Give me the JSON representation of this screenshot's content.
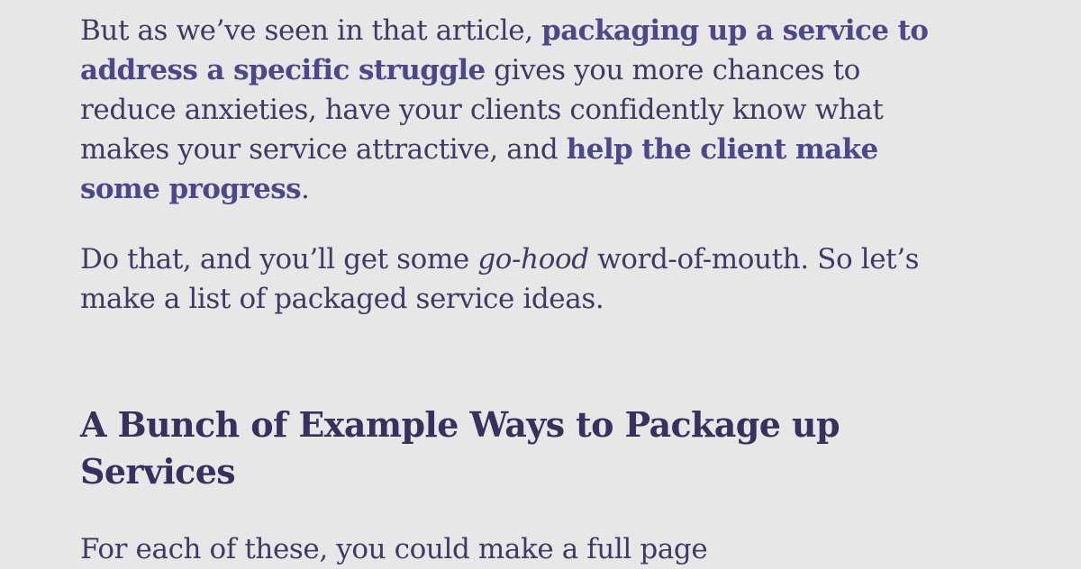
{
  "paragraph1": {
    "lead": "But as we’ve seen in that article, ",
    "bold1": "packaging up a service to address a specific struggle",
    "middle": " gives you more chances to reduce anxieties, have your clients confidently know what makes your service attractive, and ",
    "bold2": "help the client make some progress",
    "end": "."
  },
  "paragraph2": {
    "lead": "Do that, and you’ll get some ",
    "italic": "go-hood",
    "rest": " word-of-mouth. So let’s make a list of packaged service ideas."
  },
  "heading": "A Bunch of Example Ways to Package up Services",
  "paragraph3": "For each of these, you could make a full page"
}
